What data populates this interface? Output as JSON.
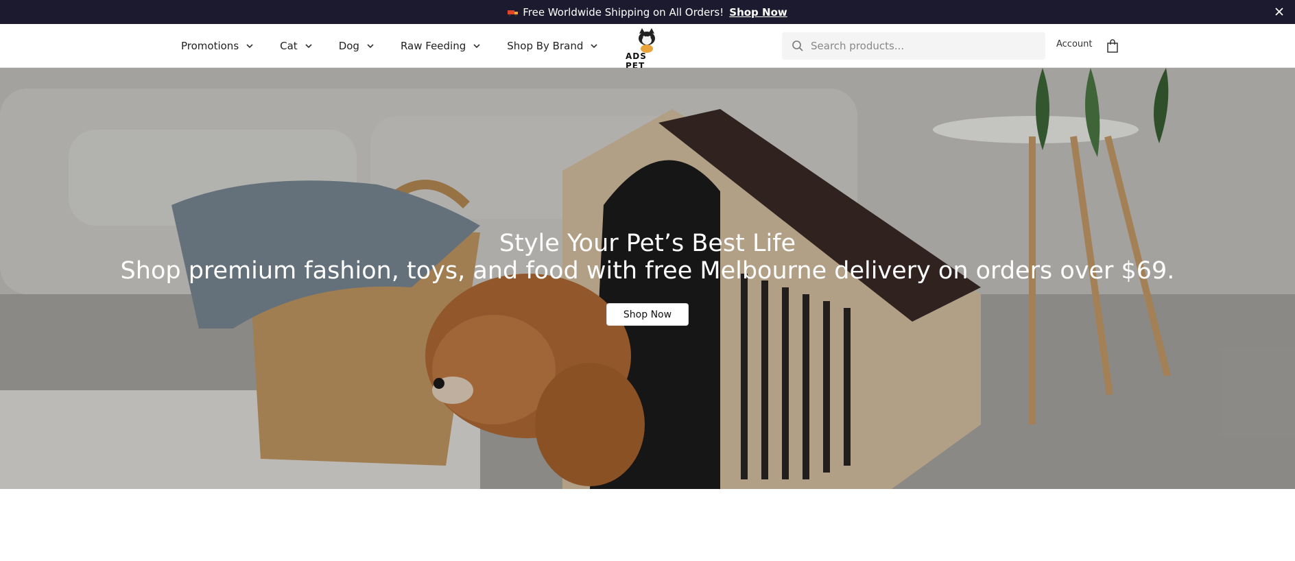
{
  "announcement": {
    "message": "Free Worldwide Shipping on All Orders!",
    "link_label": "Shop Now",
    "icon": "truck-icon",
    "close_icon": "close-icon"
  },
  "header": {
    "nav": [
      {
        "label": "Promotions"
      },
      {
        "label": "Cat"
      },
      {
        "label": "Dog"
      },
      {
        "label": "Raw Feeding"
      },
      {
        "label": "Shop By Brand"
      }
    ],
    "logo_text": "ADS PET",
    "search_placeholder": "Search products...",
    "account_label": "Account",
    "cart_icon": "shopping-bag-icon"
  },
  "hero": {
    "title": "Style Your Pet’s Best Life",
    "subtitle": "Shop premium fashion, toys, and food with free Melbourne delivery on orders over $69.",
    "button_label": "Shop Now"
  },
  "colors": {
    "announcement_bg": "#1b1a2e",
    "header_bg": "#ffffff",
    "button_bg": "#ffffff"
  }
}
